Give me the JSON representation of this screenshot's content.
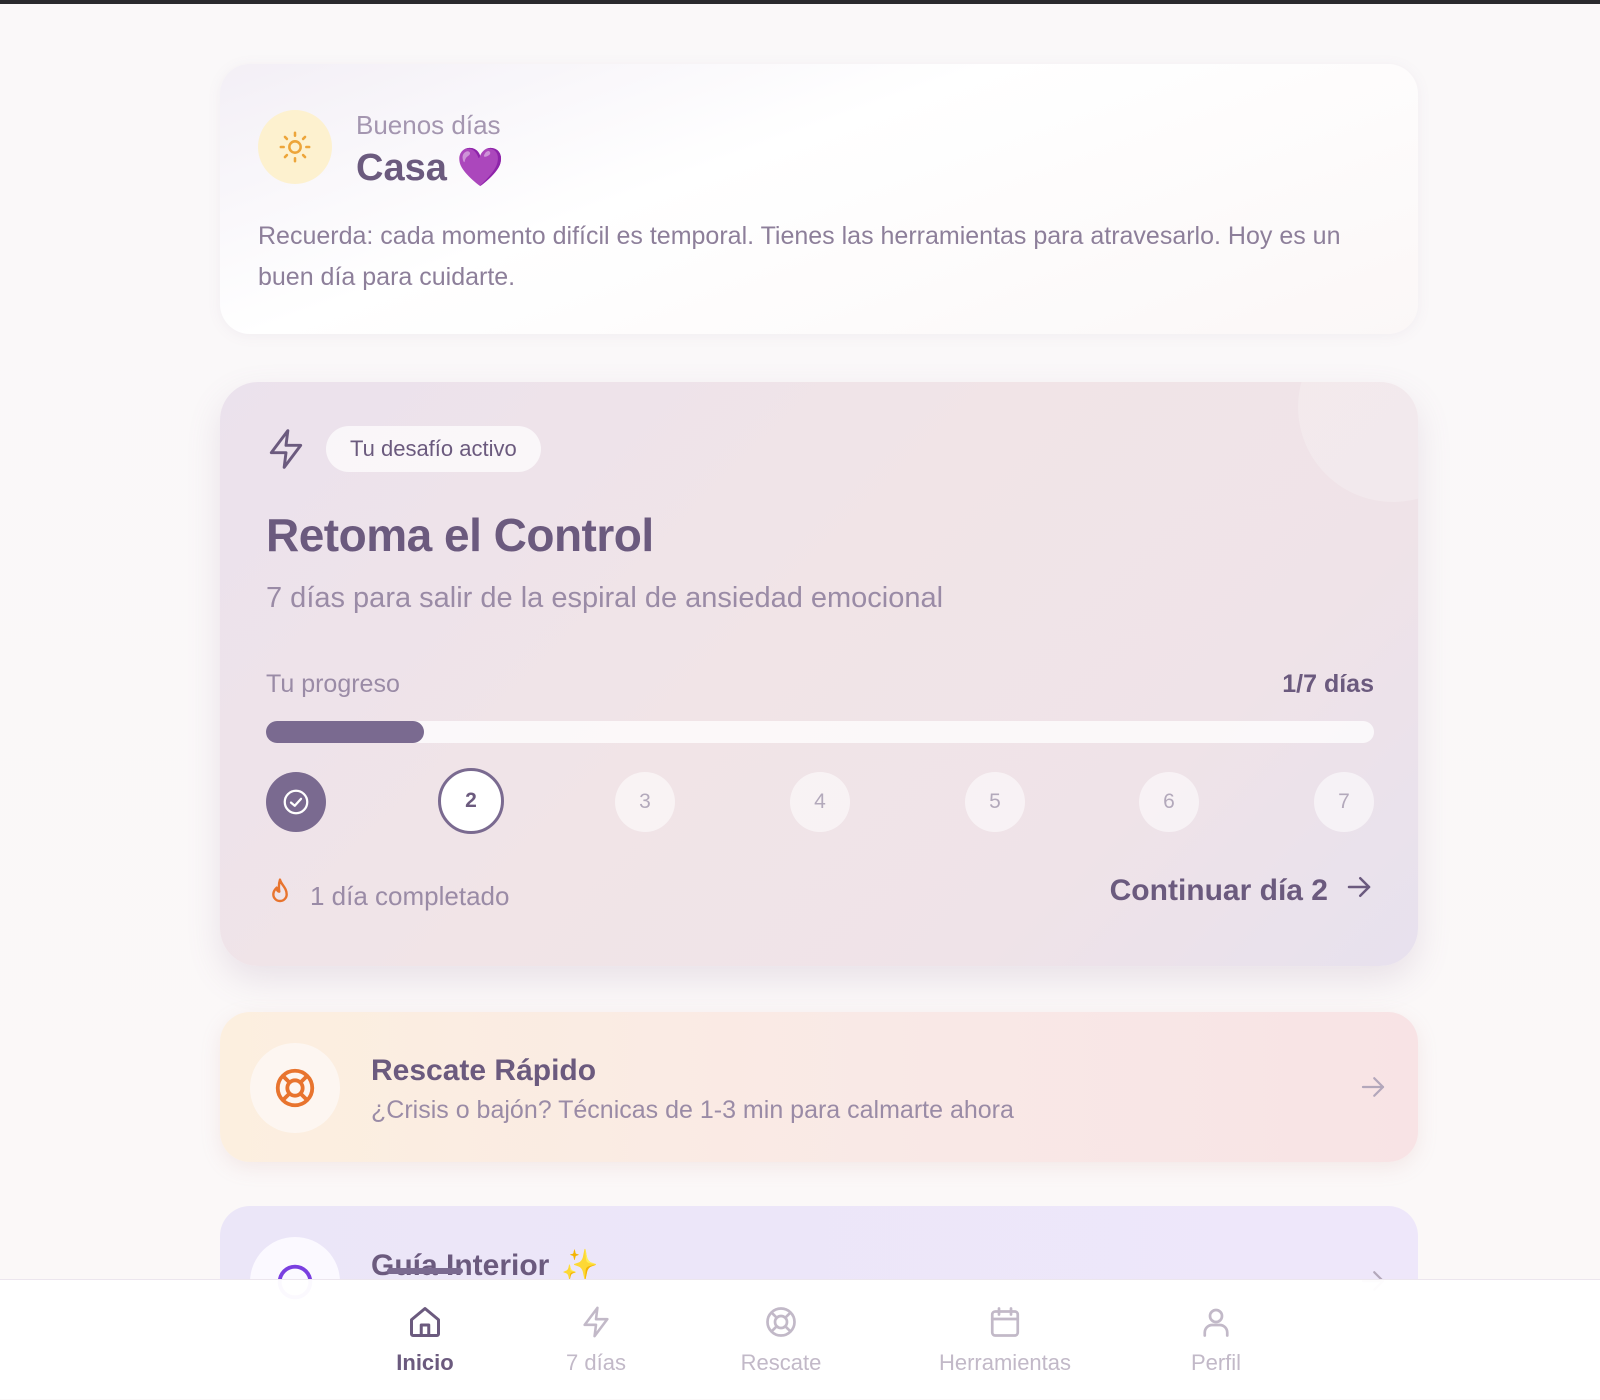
{
  "greeting": {
    "salutation": "Buenos días",
    "name": "Casa",
    "emoji": "💜",
    "message": "Recuerda: cada momento difícil es temporal. Tienes las herramientas para atravesarlo. Hoy es un buen día para cuidarte.",
    "icon": "sun-icon"
  },
  "challenge": {
    "badge": "Tu desafío activo",
    "badge_icon": "lightning-icon",
    "title": "Retoma el Control",
    "subtitle": "7 días para salir de la espiral de ansiedad emocional",
    "progress_label": "Tu progreso",
    "progress_count": "1/7 días",
    "progress_fraction": 0.1428,
    "days": [
      {
        "label": "",
        "state": "done"
      },
      {
        "label": "2",
        "state": "current"
      },
      {
        "label": "3",
        "state": "locked"
      },
      {
        "label": "4",
        "state": "locked"
      },
      {
        "label": "5",
        "state": "locked"
      },
      {
        "label": "6",
        "state": "locked"
      },
      {
        "label": "7",
        "state": "locked"
      }
    ],
    "streak_text": "1 día completado",
    "continue_label": "Continuar día 2"
  },
  "rescue_card": {
    "title": "Rescate Rápido",
    "subtitle": "¿Crisis o bajón? Técnicas de 1-3 min para calmarte ahora",
    "icon": "lifebuoy-icon"
  },
  "guide_card": {
    "title": "Guía Interior",
    "emoji": "✨"
  },
  "nav": {
    "items": [
      {
        "label": "Inicio",
        "icon": "home-icon",
        "active": true
      },
      {
        "label": "7 días",
        "icon": "lightning-icon",
        "active": false
      },
      {
        "label": "Rescate",
        "icon": "lifebuoy-icon",
        "active": false
      },
      {
        "label": "Herramientas",
        "icon": "calendar-icon",
        "active": false
      },
      {
        "label": "Perfil",
        "icon": "user-icon",
        "active": false
      }
    ]
  },
  "colors": {
    "primary": "#7a6a90",
    "text": "#6b5a7e",
    "muted": "#9a8ba6",
    "accent_orange": "#e8742e",
    "sun_bg": "#fdf1cf"
  }
}
